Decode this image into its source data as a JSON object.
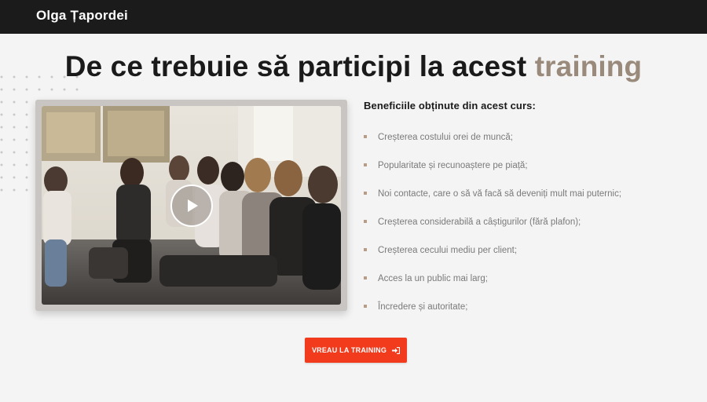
{
  "header": {
    "brand": "Olga Țapordei"
  },
  "hero": {
    "title_main": "De ce trebuie să participi la acest",
    "title_accent": "training"
  },
  "video": {
    "play_icon": "play-icon"
  },
  "benefits": {
    "title": "Beneficiile obținute din acest curs:",
    "items": [
      "Creșterea costului orei de muncă;",
      "Popularitate și recunoaștere pe piață;",
      "Noi contacte, care o să vă facă să deveniți mult mai puternic;",
      "Creșterea considerabilă a câștigurilor (fără plafon);",
      "Creșterea cecului mediu per client;",
      "Acces la un public mai larg;",
      "Încredere și autoritate;"
    ]
  },
  "cta": {
    "label": "VREAU LA TRAINING",
    "icon": "sign-in-icon"
  },
  "colors": {
    "topbar": "#1b1b1b",
    "accent": "#9a8a7b",
    "cta": "#f23a1c",
    "bullet": "#b79d86"
  }
}
